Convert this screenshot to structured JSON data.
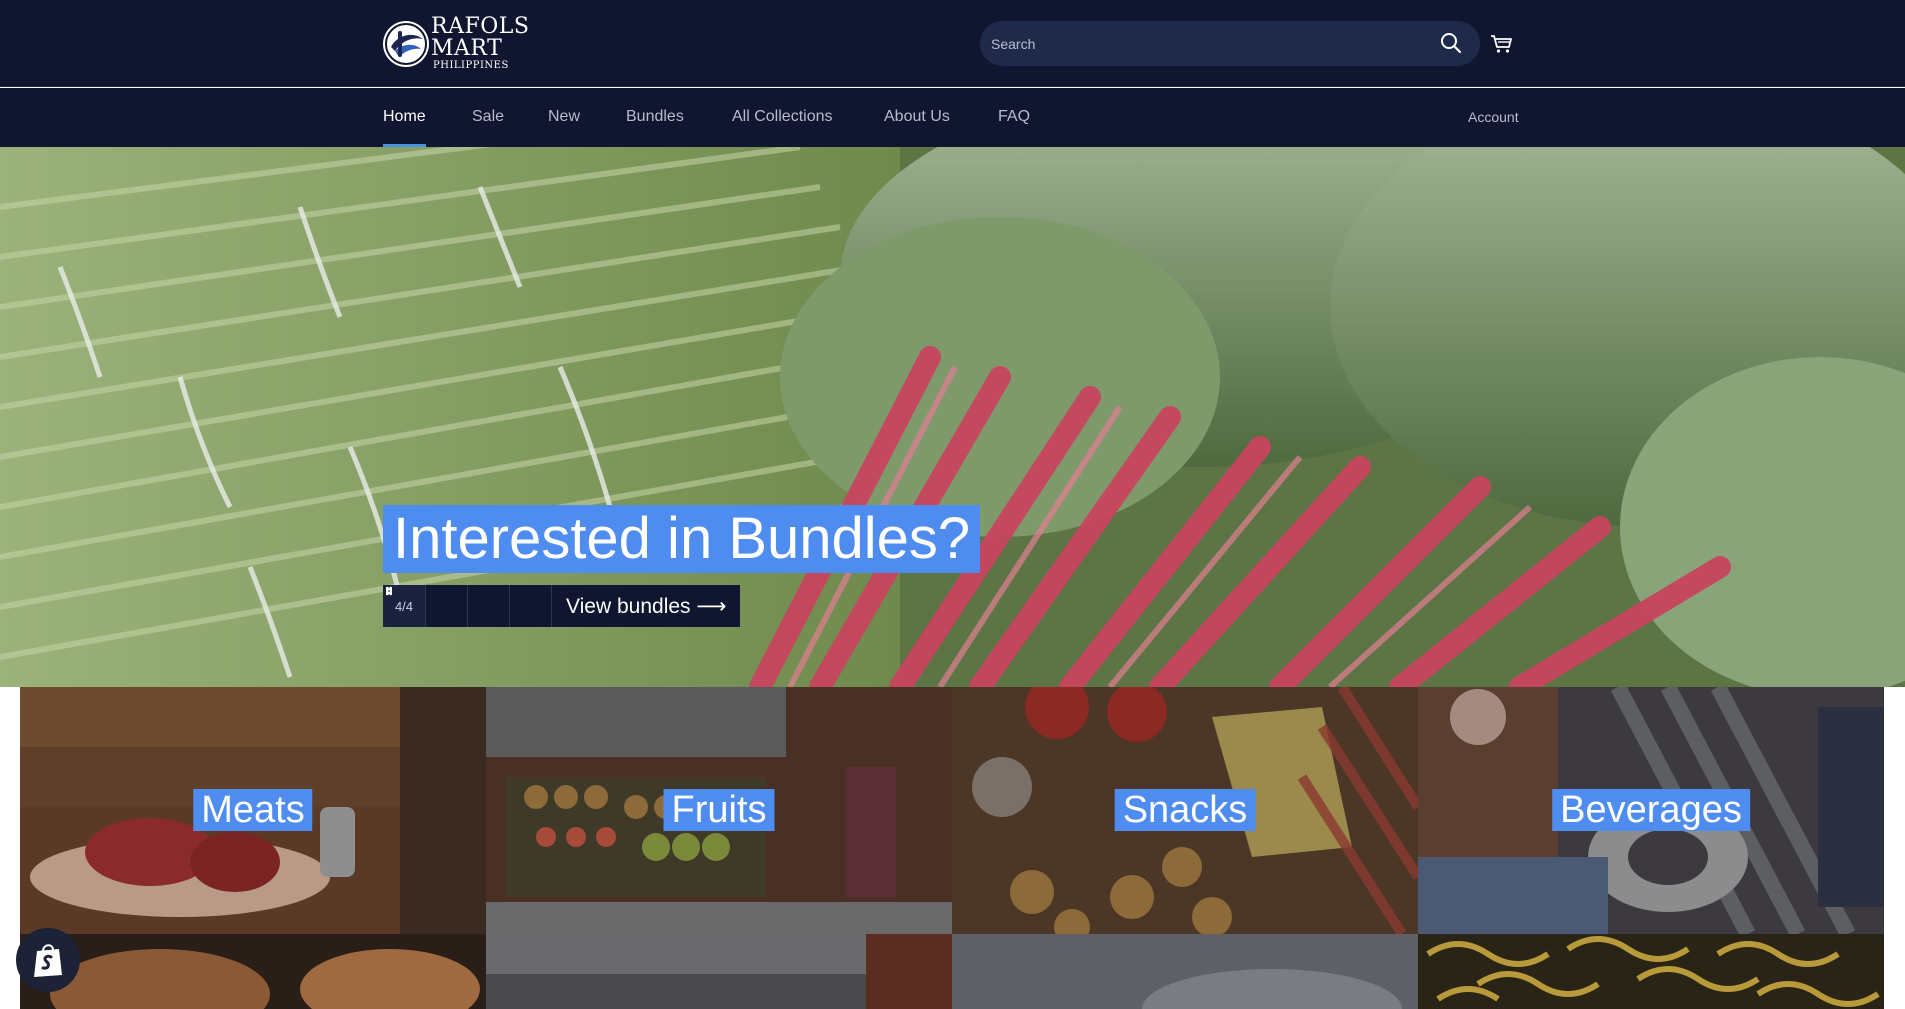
{
  "header": {
    "logo_name": "RAFOLS MART",
    "logo_sub": "PHILIPPINES",
    "search_placeholder": "Search",
    "icons": [
      "search-icon",
      "cart-icon"
    ],
    "background_color": "#101630"
  },
  "nav": {
    "items": [
      {
        "label": "Home",
        "active": true
      },
      {
        "label": "Sale",
        "active": false
      },
      {
        "label": "New",
        "active": false
      },
      {
        "label": "Bundles",
        "active": false
      },
      {
        "label": "All Collections",
        "active": false
      },
      {
        "label": "About Us",
        "active": false
      },
      {
        "label": "FAQ",
        "active": false
      }
    ],
    "account_label": "Account",
    "active_underline_color": "#4a8fe0"
  },
  "hero": {
    "title": "Interested in Bundles?",
    "slide_counter": "4/4",
    "pause_icon": "pause-icon",
    "prev_icon": "chevron-left-icon",
    "next_icon": "chevron-right-icon",
    "cta_label": "View bundles ⟶",
    "highlight_color": "#4f8cf0"
  },
  "collections": {
    "tiles": [
      {
        "label": "Meats"
      },
      {
        "label": "Fruits"
      },
      {
        "label": "Snacks"
      },
      {
        "label": "Beverages"
      }
    ]
  },
  "floating": {
    "icon": "shopify-bag-icon"
  }
}
